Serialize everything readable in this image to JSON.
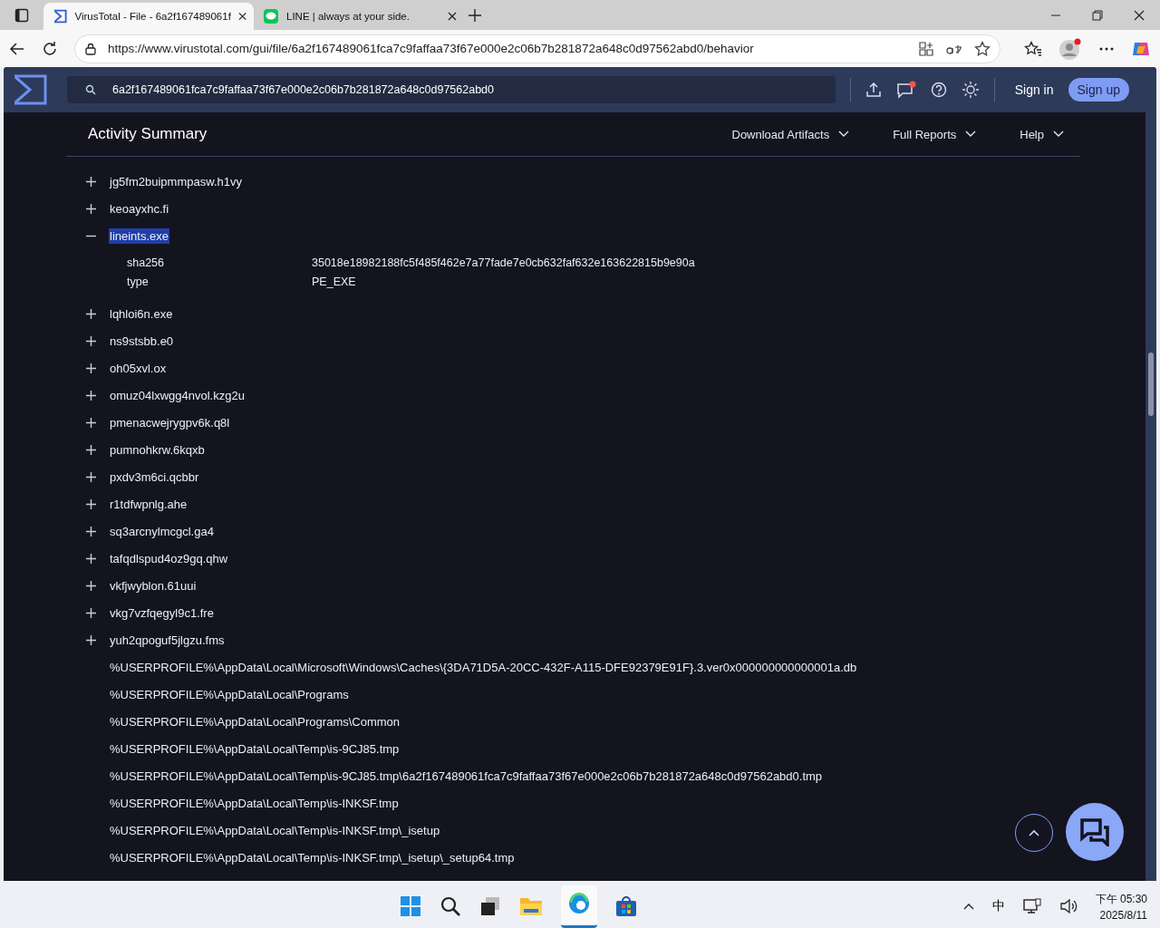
{
  "browser": {
    "tabs": [
      {
        "title": "VirusTotal - File - 6a2f167489061f",
        "selected": true,
        "kind": "sigma"
      },
      {
        "title": "LINE | always at your side.",
        "selected": false,
        "kind": "line"
      }
    ],
    "url": "https://www.virustotal.com/gui/file/6a2f167489061fca7c9faffaa73f67e000e2c06b7b281872a648c0d97562abd0/behavior"
  },
  "header": {
    "search": "6a2f167489061fca7c9faffaa73f67e000e2c06b7b281872a648c0d97562abd0",
    "sign_in": "Sign in",
    "sign_up": "Sign up"
  },
  "section": {
    "title": "Activity Summary",
    "menus": [
      "Download Artifacts",
      "Full Reports",
      "Help"
    ]
  },
  "tree": [
    {
      "kind": "file",
      "name": "jg5fm2buipmmpasw.h1vy",
      "expanded": false
    },
    {
      "kind": "file",
      "name": "keoayxhc.fi",
      "expanded": false
    },
    {
      "kind": "file",
      "name": "lineints.exe",
      "expanded": true,
      "selected": true,
      "details": [
        {
          "key": "sha256",
          "value": "35018e18982188fc5f485f462e7a77fade7e0cb632faf632e163622815b9e90a"
        },
        {
          "key": "type",
          "value": "PE_EXE"
        }
      ]
    },
    {
      "kind": "file",
      "name": "lqhloi6n.exe",
      "expanded": false
    },
    {
      "kind": "file",
      "name": "ns9stsbb.e0",
      "expanded": false
    },
    {
      "kind": "file",
      "name": "oh05xvl.ox",
      "expanded": false
    },
    {
      "kind": "file",
      "name": "omuz04lxwgg4nvol.kzg2u",
      "expanded": false
    },
    {
      "kind": "file",
      "name": "pmenacwejrygpv6k.q8l",
      "expanded": false
    },
    {
      "kind": "file",
      "name": "pumnohkrw.6kqxb",
      "expanded": false
    },
    {
      "kind": "file",
      "name": "pxdv3m6ci.qcbbr",
      "expanded": false
    },
    {
      "kind": "file",
      "name": "r1tdfwpnlg.ahe",
      "expanded": false
    },
    {
      "kind": "file",
      "name": "sq3arcnylmcgcl.ga4",
      "expanded": false
    },
    {
      "kind": "file",
      "name": "tafqdlspud4oz9gq.qhw",
      "expanded": false
    },
    {
      "kind": "file",
      "name": "vkfjwyblon.61uui",
      "expanded": false
    },
    {
      "kind": "file",
      "name": "vkg7vzfqegyl9c1.fre",
      "expanded": false
    },
    {
      "kind": "file",
      "name": "yuh2qpoguf5jlgzu.fms",
      "expanded": false
    },
    {
      "kind": "path",
      "name": "%USERPROFILE%\\AppData\\Local\\Microsoft\\Windows\\Caches\\{3DA71D5A-20CC-432F-A115-DFE92379E91F}.3.ver0x000000000000001a.db"
    },
    {
      "kind": "path",
      "name": "%USERPROFILE%\\AppData\\Local\\Programs"
    },
    {
      "kind": "path",
      "name": "%USERPROFILE%\\AppData\\Local\\Programs\\Common"
    },
    {
      "kind": "path",
      "name": "%USERPROFILE%\\AppData\\Local\\Temp\\is-9CJ85.tmp"
    },
    {
      "kind": "path",
      "name": "%USERPROFILE%\\AppData\\Local\\Temp\\is-9CJ85.tmp\\6a2f167489061fca7c9faffaa73f67e000e2c06b7b281872a648c0d97562abd0.tmp"
    },
    {
      "kind": "path",
      "name": "%USERPROFILE%\\AppData\\Local\\Temp\\is-INKSF.tmp"
    },
    {
      "kind": "path",
      "name": "%USERPROFILE%\\AppData\\Local\\Temp\\is-INKSF.tmp\\_isetup"
    },
    {
      "kind": "path",
      "name": "%USERPROFILE%\\AppData\\Local\\Temp\\is-INKSF.tmp\\_isetup\\_setup64.tmp"
    }
  ],
  "taskbar": {
    "ime": "中",
    "time": "下午 05:30",
    "date": "2025/8/11"
  }
}
